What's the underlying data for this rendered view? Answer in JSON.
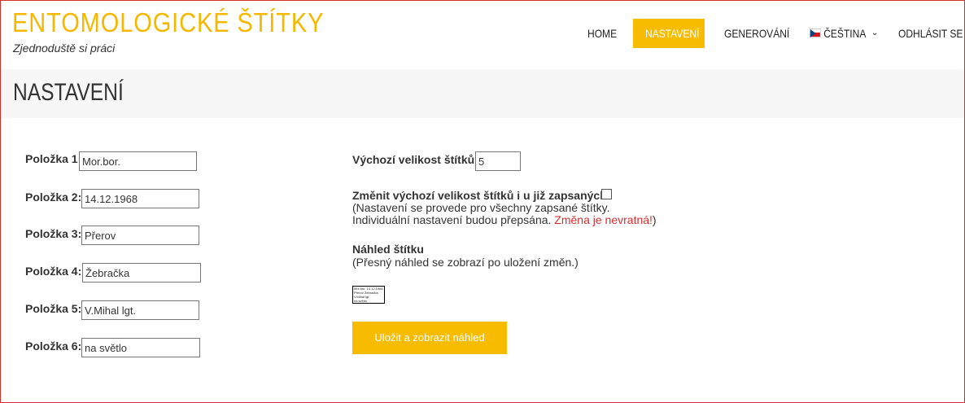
{
  "header": {
    "site_title": "ENTOMOLOGICKÉ ŠTÍTKY",
    "tagline": "Zjednoduště si práci"
  },
  "nav": {
    "home": "HOME",
    "settings": "NASTAVENÍ",
    "generate": "GENEROVÁNÍ",
    "language": "ČEŠTINA",
    "logout": "ODHLÁSIT SE",
    "language_flag_icon": "czech-flag-icon",
    "language_dropdown_icon": "chevron-down-icon",
    "accent_color": "#f7bc00"
  },
  "page": {
    "title": "NASTAVENÍ"
  },
  "items": [
    {
      "label": "Položka 1:",
      "value": "Mor.bor."
    },
    {
      "label": "Položka 2:",
      "value": "14.12.1968"
    },
    {
      "label": "Položka 3:",
      "value": "Přerov"
    },
    {
      "label": "Položka 4:",
      "value": "Žebračka"
    },
    {
      "label": "Položka 5:",
      "value": "V.Mihal lgt."
    },
    {
      "label": "Položka 6:",
      "value": "na světlo"
    }
  ],
  "settings": {
    "default_size_label": "Výchozí velikost štítků:",
    "default_size_value": "5",
    "change_existing_label": "Změnit výchozí velikost štítků i u již zapsaných:",
    "change_existing_checked": false,
    "note_line1": "(Nastavení se provede pro všechny zapsané štítky.",
    "note_line2": "Individuální nastavení budou přepsána. ",
    "note_warning": "Změna je nevratná!",
    "note_close": ")",
    "preview_title": "Náhled štítku",
    "preview_note": "(Přesný náhled se zobrazí po uložení změn.)",
    "preview_lines": [
      "Mor.bor. 14.12.1968",
      "Přerov Žebračka",
      "V.Mihal lgt.",
      "na světlo"
    ],
    "save_button": "Uložit a zobrazit náhled",
    "warning_color": "#d32f2f"
  }
}
